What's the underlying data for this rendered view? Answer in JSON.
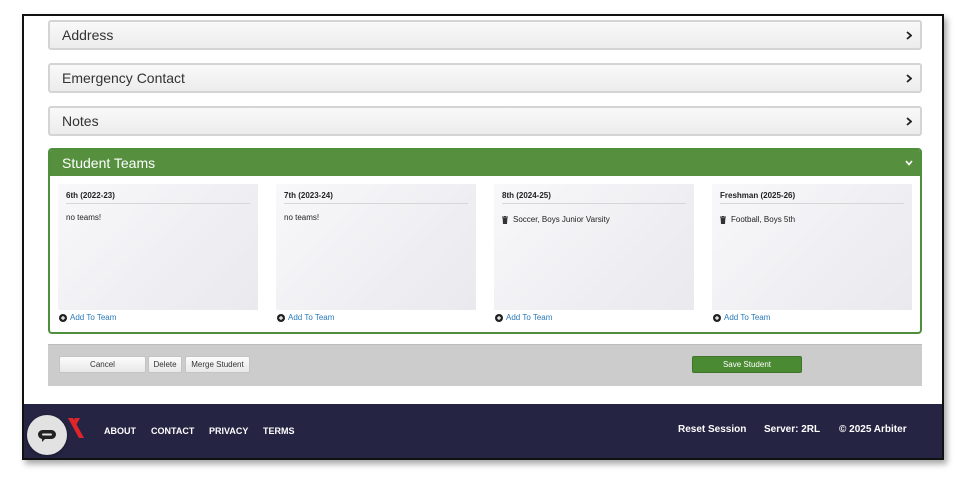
{
  "panels": {
    "address": "Address",
    "emergency": "Emergency Contact",
    "notes": "Notes"
  },
  "student_teams": {
    "title": "Student Teams",
    "columns": [
      {
        "title": "6th (2022-23)",
        "empty_text": "no teams!",
        "add_label": "Add To Team"
      },
      {
        "title": "7th (2023-24)",
        "empty_text": "no teams!",
        "add_label": "Add To Team"
      },
      {
        "title": "8th (2024-25)",
        "team": "Soccer, Boys Junior Varsity",
        "add_label": "Add To Team"
      },
      {
        "title": "Freshman (2025-26)",
        "team": "Football, Boys 5th",
        "add_label": "Add To Team"
      }
    ]
  },
  "actions": {
    "cancel": "Cancel",
    "delete": "Delete",
    "merge": "Merge Student",
    "save": "Save Student"
  },
  "footer": {
    "about": "ABOUT",
    "contact": "CONTACT",
    "privacy": "PRIVACY",
    "terms": "TERMS",
    "reset": "Reset Session",
    "server": "Server: 2RL",
    "copyright": "© 2025 Arbiter"
  },
  "colors": {
    "accent_green": "#56903f",
    "footer_bg": "#262443",
    "link_blue": "#2a7ab8",
    "logo_red": "#e0242b"
  },
  "icons": {
    "chevron_right": "chevron-right-icon",
    "chevron_down": "chevron-down-icon",
    "trash": "trash-icon",
    "add": "plus-circle-icon",
    "chat": "chat-icon"
  }
}
